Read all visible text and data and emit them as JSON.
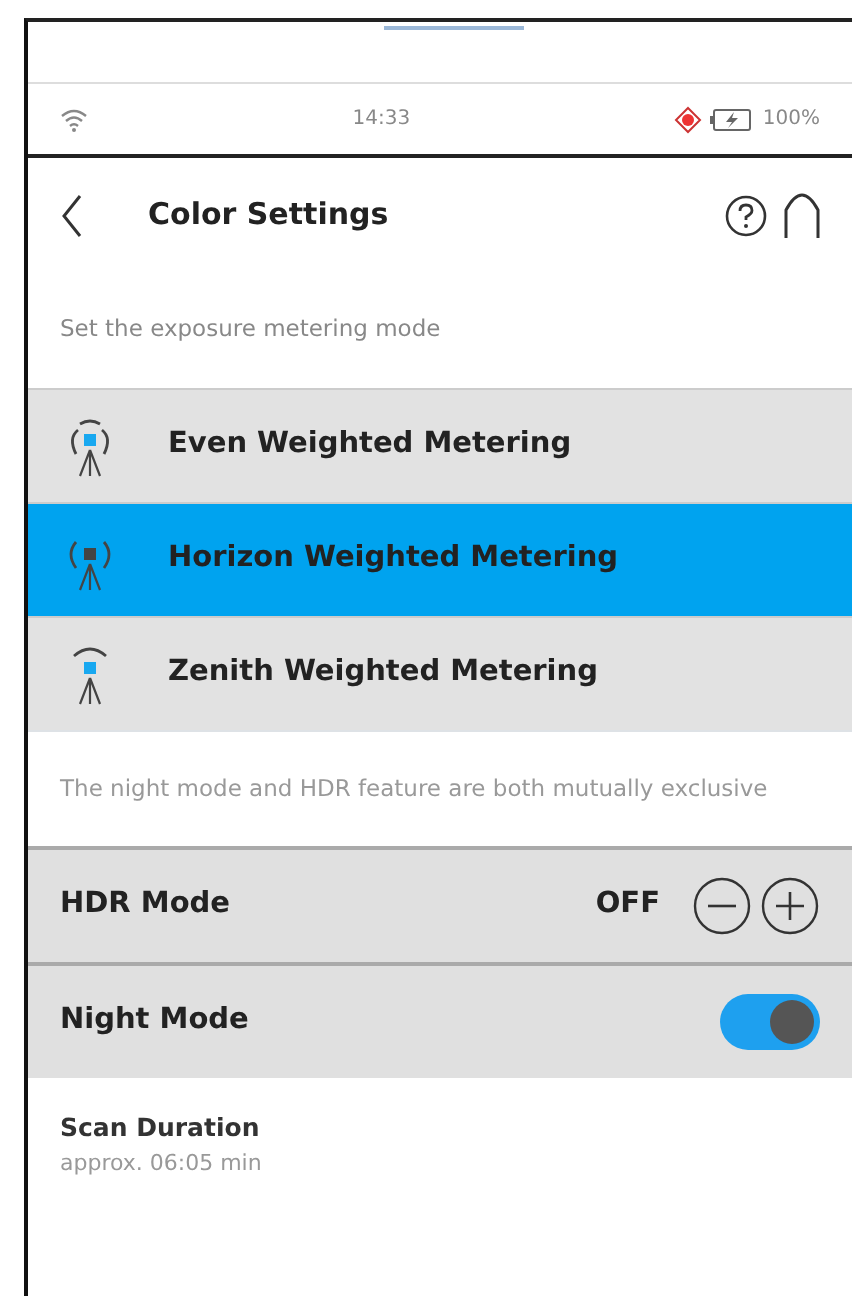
{
  "status_bar": {
    "time": "14:33",
    "battery": "100%"
  },
  "header": {
    "title": "Color Settings"
  },
  "metering": {
    "hint": "Set the exposure metering mode",
    "options": [
      {
        "kind": "even",
        "label": "Even Weighted Metering",
        "selected": false
      },
      {
        "kind": "horizon",
        "label": "Horizon Weighted Metering",
        "selected": true
      },
      {
        "kind": "zenith",
        "label": "Zenith Weighted Metering",
        "selected": false
      }
    ]
  },
  "note": "The night mode and HDR feature are both mutually exclusive",
  "settings": [
    {
      "kind": "stepper",
      "label": "HDR Mode",
      "value": "OFF"
    },
    {
      "kind": "toggle",
      "label": "Night Mode",
      "on": true
    }
  ],
  "scan": {
    "label": "Scan Duration",
    "value": "approx. 06:05 min"
  }
}
